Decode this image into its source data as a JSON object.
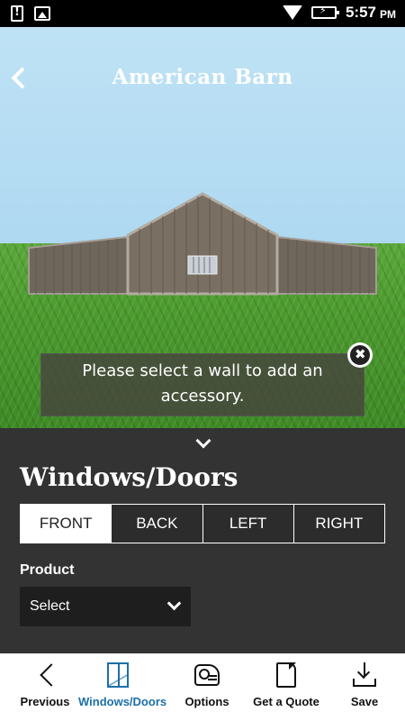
{
  "status_bar": {
    "time": "5:57",
    "ampm": "PM"
  },
  "header": {
    "title": "American Barn"
  },
  "toast": {
    "message": "Please select a wall to add an accessory."
  },
  "panel": {
    "title": "Windows/Doors",
    "wall_tabs": [
      {
        "label": "FRONT",
        "active": true
      },
      {
        "label": "BACK",
        "active": false
      },
      {
        "label": "LEFT",
        "active": false
      },
      {
        "label": "RIGHT",
        "active": false
      }
    ],
    "product_label": "Product",
    "product_select": "Select"
  },
  "bottom_nav": [
    {
      "label": "Previous",
      "icon": "chevron-left-icon",
      "active": false
    },
    {
      "label": "Windows/Doors",
      "icon": "window-icon",
      "active": true
    },
    {
      "label": "Options",
      "icon": "options-icon",
      "active": false
    },
    {
      "label": "Get a Quote",
      "icon": "document-icon",
      "active": false
    },
    {
      "label": "Save",
      "icon": "download-icon",
      "active": false
    }
  ],
  "colors": {
    "accent": "#1d6fa8",
    "panel_bg": "#333333",
    "barn_wall": "#7a6f63"
  }
}
